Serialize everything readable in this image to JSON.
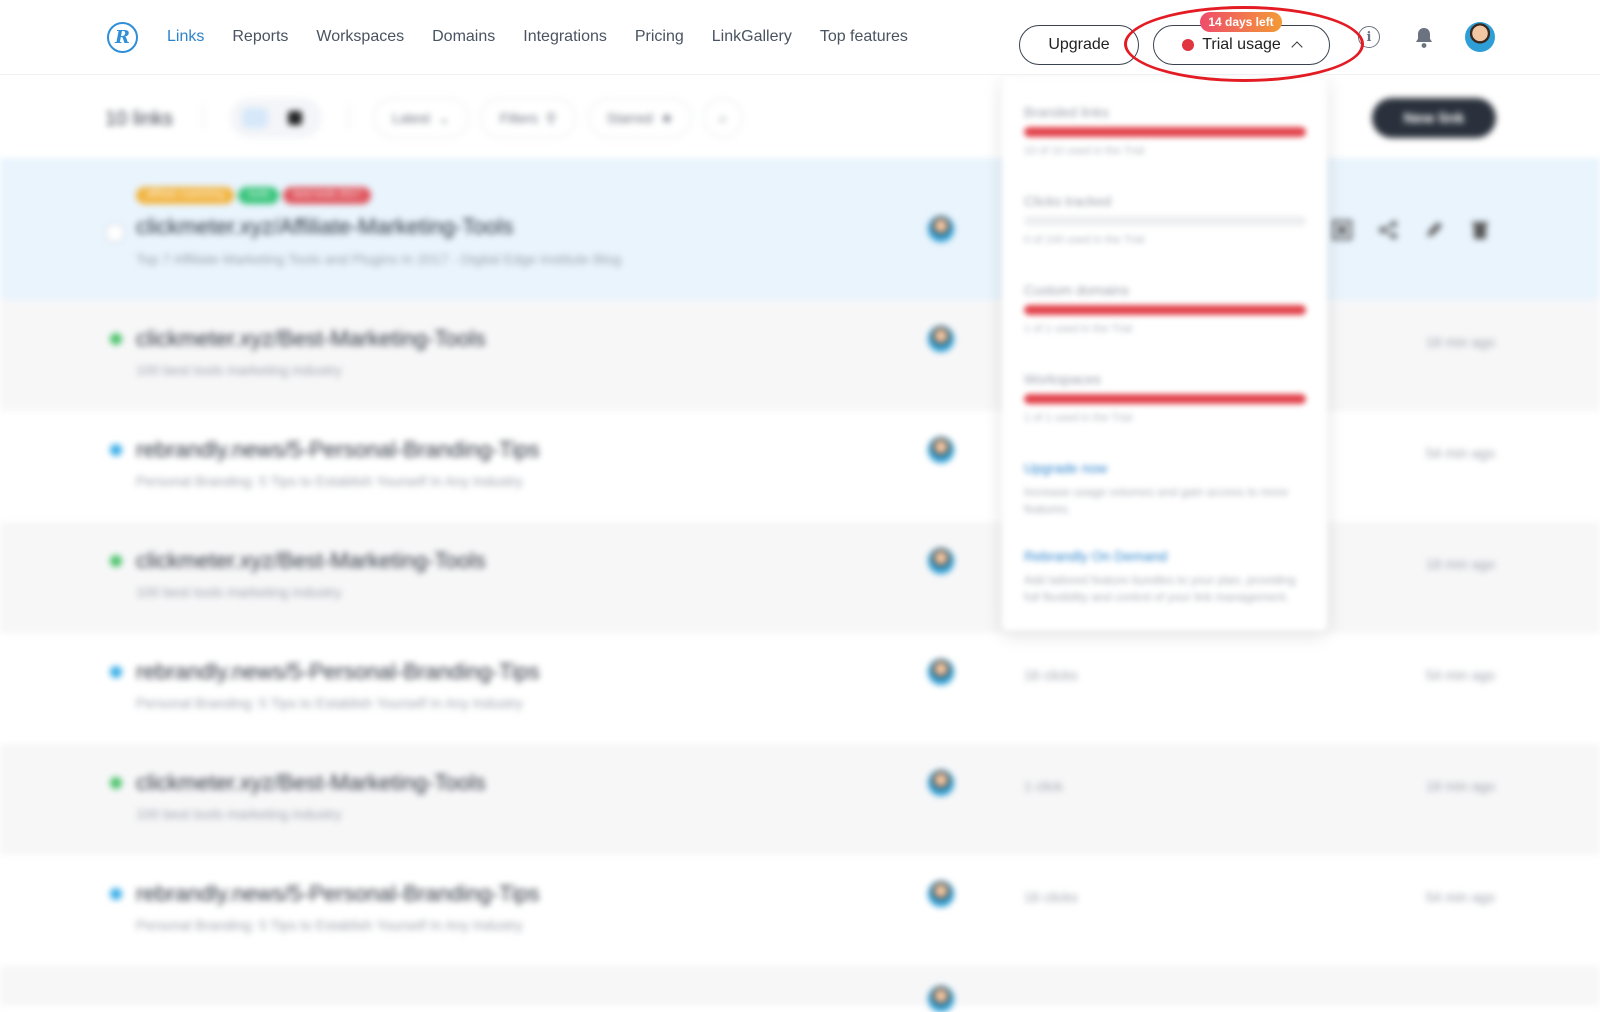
{
  "brand": {
    "logo_letter": "R",
    "accent": "#2c84cc"
  },
  "nav": {
    "items": [
      "Links",
      "Reports",
      "Workspaces",
      "Domains",
      "Integrations",
      "Pricing",
      "LinkGallery",
      "Top features"
    ],
    "active": "Links"
  },
  "header": {
    "upgrade_label": "Upgrade",
    "trial_label": "Trial usage",
    "trial_status_color": "#e0343f",
    "days_badge": "14 days left",
    "info_icon": "info-icon",
    "bell_icon": "bell-icon"
  },
  "toolbar": {
    "link_count": "10 links",
    "sort_label": "Latest",
    "filters_label": "Filters",
    "starred_label": "Starred",
    "new_link_label": "New link"
  },
  "trial_dropdown": {
    "items": [
      {
        "label": "Branded links",
        "usage": "10 of 10 used in the Trial",
        "fill": 1.0
      },
      {
        "label": "Clicks tracked",
        "usage": "0 of 100 used in the Trial",
        "fill": 0.0
      },
      {
        "label": "Custom domains",
        "usage": "1 of 1 used in the Trial",
        "fill": 1.0
      },
      {
        "label": "Workspaces",
        "usage": "1 of 1 used in the Trial",
        "fill": 1.0
      }
    ],
    "upgrade_now": "Upgrade now",
    "upgrade_desc": "Increase usage volumes and gain access to more features.",
    "on_demand": "Rebrandly On Demand",
    "on_demand_desc": "Add tailored feature bundles to your plan, providing full flexibility and control of your link management."
  },
  "links": {
    "rows": [
      {
        "url": "clickmeter.xyz/Affiliate-Marketing-Tools",
        "title": "Top 7 Affiliate Marketing Tools and Plugins In 2017 - Digital Edge Institute Blog",
        "clicks": "",
        "ago": "",
        "dot_color": "",
        "selected": true
      },
      {
        "url": "clickmeter.xyz/Best-Marketing-Tools",
        "title": "100 best tools marketing industry",
        "clicks": "",
        "ago": "18 min ago",
        "dot_color": "#4cc36b",
        "selected": false
      },
      {
        "url": "rebrandly.news/5-Personal-Branding-Tips",
        "title": "Personal Branding: 5 Tips to Establish Yourself In Any Industry",
        "clicks": "",
        "ago": "54 min ago",
        "dot_color": "#3aaee8",
        "selected": false
      },
      {
        "url": "clickmeter.xyz/Best-Marketing-Tools",
        "title": "100 best tools marketing industry",
        "clicks": "",
        "ago": "18 min ago",
        "dot_color": "#4cc36b",
        "selected": false
      },
      {
        "url": "rebrandly.news/5-Personal-Branding-Tips",
        "title": "Personal Branding: 5 Tips to Establish Yourself In Any Industry",
        "clicks": "16 clicks",
        "ago": "54 min ago",
        "dot_color": "#3aaee8",
        "selected": false
      },
      {
        "url": "clickmeter.xyz/Best-Marketing-Tools",
        "title": "100 best tools marketing industry",
        "clicks": "1 click",
        "ago": "18 min ago",
        "dot_color": "#4cc36b",
        "selected": false
      },
      {
        "url": "rebrandly.news/5-Personal-Branding-Tips",
        "title": "Personal Branding: 5 Tips to Establish Yourself In Any Industry",
        "clicks": "16 clicks",
        "ago": "54 min ago",
        "dot_color": "#3aaee8",
        "selected": false
      }
    ],
    "tags": [
      {
        "label": "affiliate marketing",
        "color": "#f2b33d"
      },
      {
        "label": "tools",
        "color": "#37c47a"
      },
      {
        "label": "best tools 2017",
        "color": "#e0565e"
      }
    ]
  }
}
